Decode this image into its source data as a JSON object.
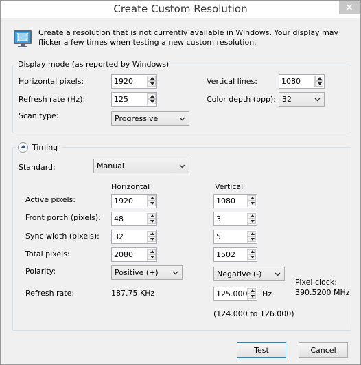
{
  "window": {
    "title": "Create Custom Resolution",
    "close_glyph": "×"
  },
  "intro": "Create a resolution that is not currently available in Windows. Your display may flicker a few times when testing a new custom resolution.",
  "display_mode": {
    "group_label": "Display mode (as reported by Windows)",
    "horizontal_pixels_label": "Horizontal pixels:",
    "horizontal_pixels_value": "1920",
    "vertical_lines_label": "Vertical lines:",
    "vertical_lines_value": "1080",
    "refresh_rate_label": "Refresh rate (Hz):",
    "refresh_rate_value": "125",
    "color_depth_label": "Color depth (bpp):",
    "color_depth_value": "32",
    "scan_type_label": "Scan type:",
    "scan_type_value": "Progressive"
  },
  "timing": {
    "group_label": "Timing",
    "standard_label": "Standard:",
    "standard_value": "Manual",
    "col_horizontal": "Horizontal",
    "col_vertical": "Vertical",
    "rows": [
      {
        "label": "Active pixels:",
        "h": "1920",
        "v": "1080"
      },
      {
        "label": "Front porch (pixels):",
        "h": "48",
        "v": "3"
      },
      {
        "label": "Sync width (pixels):",
        "h": "32",
        "v": "5"
      },
      {
        "label": "Total pixels:",
        "h": "2080",
        "v": "1502"
      }
    ],
    "polarity_label": "Polarity:",
    "polarity_h": "Positive (+)",
    "polarity_v": "Negative (-)",
    "refresh_rate_label": "Refresh rate:",
    "refresh_rate_h": "187.75 KHz",
    "refresh_rate_v": "125.000",
    "refresh_unit": "Hz",
    "refresh_range": "(124.000 to 126.000)",
    "pixel_clock_label": "Pixel clock:",
    "pixel_clock_value": "390.5200 MHz"
  },
  "buttons": {
    "test": "Test",
    "cancel": "Cancel"
  }
}
